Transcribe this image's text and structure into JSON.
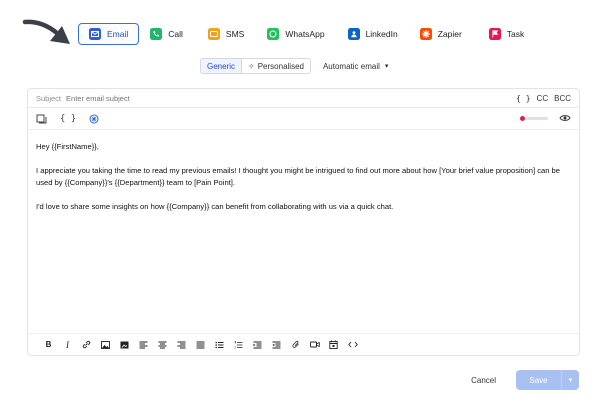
{
  "channels": [
    {
      "label": "Email",
      "icon": "envelope-icon",
      "color": "#2b5fd9"
    },
    {
      "label": "Call",
      "icon": "phone-icon",
      "color": "#22b468"
    },
    {
      "label": "SMS",
      "icon": "sms-icon",
      "color": "#f2a11d"
    },
    {
      "label": "WhatsApp",
      "icon": "whatsapp-icon",
      "color": "#25c05a"
    },
    {
      "label": "LinkedIn",
      "icon": "linkedin-icon",
      "color": "#0a66c2"
    },
    {
      "label": "Zapier",
      "icon": "zapier-icon",
      "color": "#ff4a00"
    },
    {
      "label": "Task",
      "icon": "flag-icon",
      "color": "#e8174f"
    }
  ],
  "modes": {
    "generic": "Generic",
    "personalised": "Personalised",
    "automatic": "Automatic email"
  },
  "subject": {
    "label": "Subject",
    "placeholder": "Enter email subject",
    "cc": "CC",
    "bcc": "BCC",
    "braces": "{ }"
  },
  "body": {
    "greeting": "Hey {{FirstName}},",
    "para1": "I appreciate you taking the time to read my previous emails! I thought you might be intrigued to find out more about how [Your brief value proposition] can be used by {{Company}}'s {{Department}} team to [Pain Point].",
    "para2": "I'd love to share some insights on how {{Company}} can benefit from collaborating with us via a quick chat."
  },
  "toolbar": {
    "braces": "{ }"
  },
  "formatting": {
    "bold": "B",
    "italic": "I"
  },
  "actions": {
    "cancel": "Cancel",
    "save": "Save"
  },
  "colors": {
    "accent": "#3b6fd8",
    "save_bg": "#a8c1f2",
    "meter_dot": "#e0203c"
  }
}
